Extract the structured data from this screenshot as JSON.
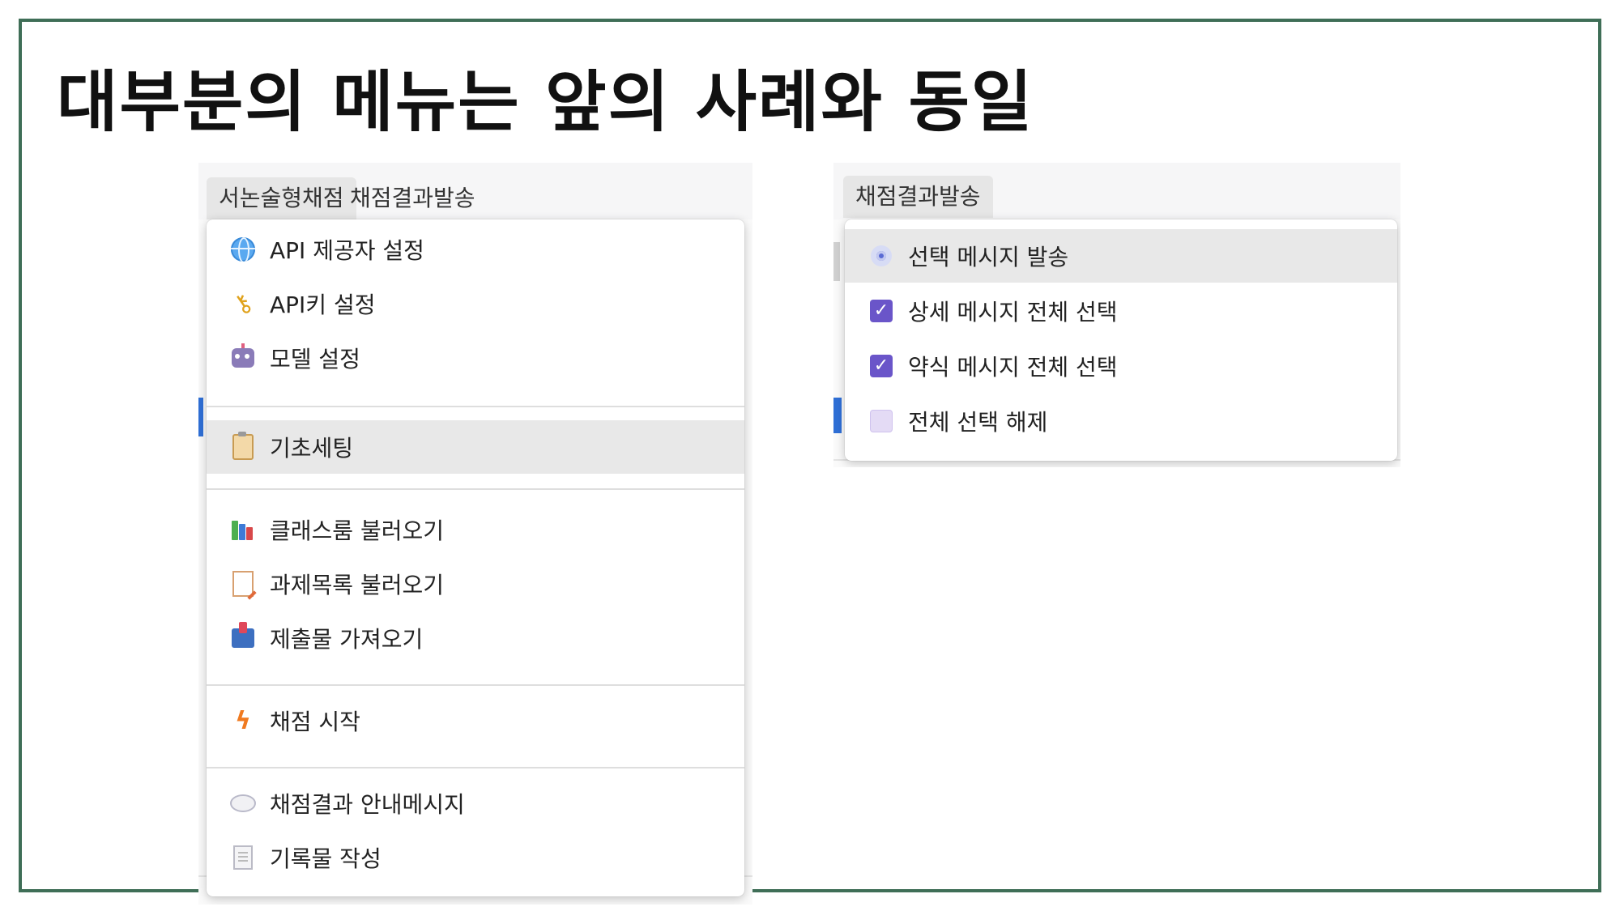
{
  "slide": {
    "title": "대부분의 메뉴는 앞의 사례와 동일"
  },
  "left_screenshot": {
    "menubar": {
      "tabs": [
        "서논술형채점",
        "채점결과발송"
      ]
    },
    "menu": {
      "items": [
        {
          "label": "API 제공자 설정",
          "icon": "globe-icon"
        },
        {
          "label": "API키 설정",
          "icon": "key-icon"
        },
        {
          "label": "모델 설정",
          "icon": "robot-icon"
        },
        {
          "label": "기초세팅",
          "icon": "clipboard-icon",
          "highlighted": true
        },
        {
          "label": "클래스룸 불러오기",
          "icon": "books-icon"
        },
        {
          "label": "과제목록 불러오기",
          "icon": "memo-icon"
        },
        {
          "label": "제출물 가져오기",
          "icon": "inbox-tray-icon"
        },
        {
          "label": "채점 시작",
          "icon": "lightning-icon"
        },
        {
          "label": "채점결과 안내메시지",
          "icon": "speech-bubble-icon"
        },
        {
          "label": "기록물 작성",
          "icon": "document-icon"
        }
      ]
    }
  },
  "right_screenshot": {
    "menubar": {
      "tabs": [
        "채점결과발송"
      ]
    },
    "menu": {
      "items": [
        {
          "label": "선택 메시지 발송",
          "icon": "send-icon",
          "highlighted": true
        },
        {
          "label": "상세 메시지 전체 선택",
          "icon": "checkbox-checked-icon"
        },
        {
          "label": "약식 메시지 전체 선택",
          "icon": "checkbox-checked-icon"
        },
        {
          "label": "전체 선택 해제",
          "icon": "checkbox-empty-icon"
        }
      ]
    }
  },
  "colors": {
    "slide_border": "#3f6e57",
    "highlight": "#e8e8e8",
    "check_purple": "#6a55c9"
  }
}
